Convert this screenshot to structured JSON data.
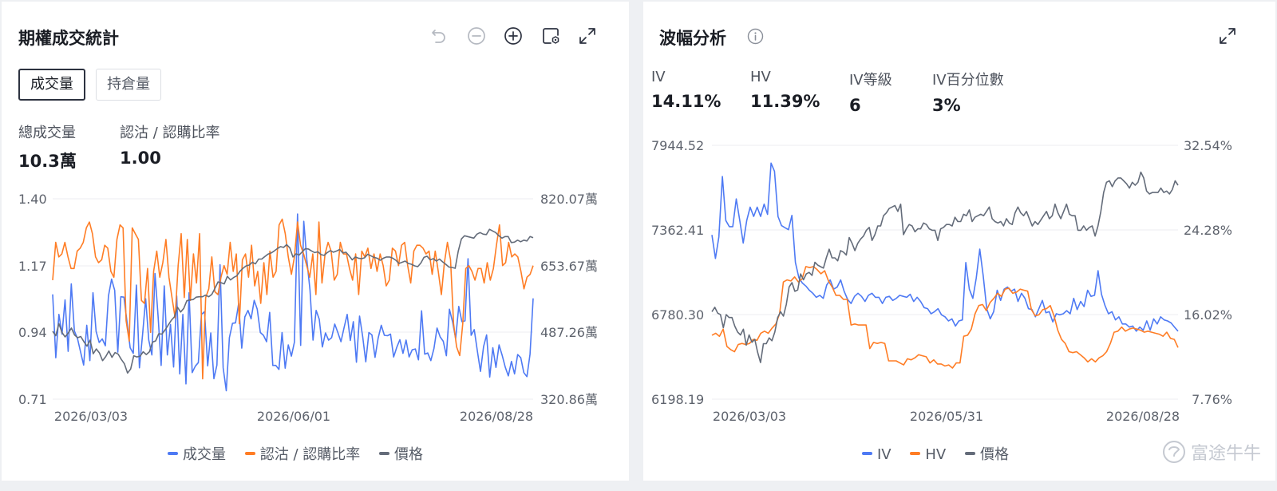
{
  "colors": {
    "volume": "#4e7af4",
    "ratio": "#ff7d25",
    "price": "#646c7a",
    "iv": "#4e7af4",
    "hv": "#ff7d25",
    "grid": "#eceef1"
  },
  "left": {
    "title": "期權成交統計",
    "toolbar_icons": [
      "undo-icon",
      "zoom-out-icon",
      "zoom-in-icon",
      "settings-icon",
      "fullscreen-icon"
    ],
    "tabs": [
      {
        "label": "成交量",
        "active": true
      },
      {
        "label": "持倉量",
        "active": false
      }
    ],
    "stats": [
      {
        "label": "總成交量",
        "value": "10.3萬"
      },
      {
        "label": "認沽 / 認購比率",
        "value": "1.00"
      }
    ],
    "legend": [
      "成交量",
      "認沽 / 認購比率",
      "價格"
    ]
  },
  "right": {
    "title": "波幅分析",
    "stats": [
      {
        "label": "IV",
        "value": "14.11%"
      },
      {
        "label": "HV",
        "value": "11.39%"
      },
      {
        "label": "IV等級",
        "value": "6"
      },
      {
        "label": "IV百分位數",
        "value": "3%"
      }
    ],
    "legend": [
      "IV",
      "HV",
      "價格"
    ]
  },
  "watermark": "富途牛牛",
  "chart_data": [
    {
      "type": "line",
      "title": "期權成交統計",
      "x_ticks": [
        "2026/03/03",
        "2026/06/01",
        "2026/08/28"
      ],
      "y_left_ticks": [
        "1.40",
        "1.17",
        "0.94",
        "0.71"
      ],
      "y_left_range": [
        0.71,
        1.4
      ],
      "y_right_ticks": [
        "820.07萬",
        "653.67萬",
        "487.26萬",
        "320.86萬"
      ],
      "y_right_range": [
        320.86,
        820.07
      ],
      "y_right_unit": "萬",
      "grid": true,
      "legend_position": "bottom",
      "series": [
        {
          "name": "成交量",
          "axis": "right",
          "values": [
            582,
            424,
            532,
            483,
            568,
            440,
            608,
            491,
            472,
            438,
            406,
            505,
            417,
            586,
            490,
            462,
            471,
            454,
            578,
            620,
            592,
            438,
            576,
            575,
            512,
            449,
            435,
            605,
            399,
            481,
            571,
            468,
            431,
            634,
            527,
            405,
            603,
            431,
            507,
            401,
            578,
            384,
            532,
            359,
            586,
            387,
            403,
            412,
            532,
            539,
            404,
            486,
            372,
            406,
            656,
            399,
            342,
            474,
            510,
            511,
            559,
            448,
            526,
            542,
            521,
            567,
            545,
            487,
            480,
            464,
            537,
            405,
            405,
            395,
            487,
            398,
            456,
            428,
            463,
            782,
            455,
            764,
            667,
            593,
            468,
            542,
            520,
            451,
            486,
            468,
            474,
            508,
            487,
            464,
            499,
            532,
            467,
            514,
            413,
            528,
            477,
            414,
            487,
            481,
            425,
            473,
            505,
            480,
            479,
            483,
            426,
            450,
            469,
            435,
            468,
            426,
            444,
            446,
            419,
            541,
            433,
            436,
            417,
            447,
            498,
            476,
            465,
            429,
            545,
            514,
            472,
            552,
            514,
            516,
            671,
            480,
            494,
            441,
            390,
            452,
            481,
            376,
            449,
            400,
            456,
            430,
            401,
            379,
            415,
            384,
            432,
            424,
            387,
            377,
            433,
            572
          ]
        },
        {
          "name": "認沽 / 認購比率",
          "axis": "left",
          "values": [
            1.12,
            1.25,
            1.2,
            1.21,
            1.25,
            1.2,
            1.16,
            1.16,
            1.22,
            1.23,
            1.25,
            1.3,
            1.32,
            1.28,
            1.2,
            1.18,
            1.19,
            1.24,
            1.23,
            1.15,
            1.13,
            1.26,
            1.31,
            1.3,
            0.98,
            0.91,
            1.3,
            1.28,
            1.26,
            1.05,
            1.04,
            1.16,
            0.94,
            1.15,
            1.22,
            1.13,
            1.18,
            1.26,
            1.13,
            1.06,
            0.99,
            1.17,
            1.28,
            1.06,
            1.26,
            1.05,
            1.21,
            1.11,
            1.28,
            0.78,
            1.06,
            1.09,
            1.2,
            1.08,
            1.07,
            1.13,
            1.17,
            1.14,
            1.25,
            1.15,
            1.21,
            0.97,
            1.19,
            1.21,
            1.13,
            1.24,
            1.1,
            1.15,
            1.04,
            1.18,
            1.07,
            1.22,
            1.13,
            1.15,
            1.31,
            1.33,
            1.28,
            1.2,
            1.14,
            1.2,
            1.32,
            1.24,
            1.21,
            1.17,
            1.13,
            1.21,
            1.07,
            1.32,
            1.11,
            1.21,
            1.25,
            1.22,
            1.12,
            1.14,
            1.25,
            1.21,
            1.21,
            1.16,
            1.12,
            1.21,
            1.07,
            1.22,
            1.2,
            1.23,
            1.16,
            1.21,
            1.15,
            1.21,
            1.17,
            1.1,
            1.12,
            1.23,
            1.22,
            1.17,
            1.24,
            1.25,
            1.17,
            1.11,
            1.22,
            1.24,
            1.24,
            1.23,
            1.21,
            1.22,
            1.14,
            1.22,
            1.15,
            1.07,
            1.18,
            1.25,
            1.19,
            0.97,
            0.89,
            0.86,
            0.97,
            1.16,
            1.17,
            1.15,
            1.12,
            1.16,
            1.16,
            1.11,
            1.18,
            1.12,
            1.16,
            1.24,
            1.31,
            1.17,
            1.18,
            1.25,
            1.2,
            1.21,
            1.2,
            1.15,
            1.09,
            1.13,
            1.14,
            1.17
          ]
        },
        {
          "name": "價格",
          "axis": "right",
          "values": [
            490,
            479,
            509,
            487,
            476,
            486,
            498,
            481,
            474,
            477,
            464,
            453,
            468,
            434,
            446,
            436,
            417,
            427,
            441,
            425,
            437,
            433,
            420,
            409,
            386,
            396,
            429,
            426,
            428,
            439,
            432,
            439,
            463,
            466,
            484,
            483,
            493,
            505,
            517,
            526,
            550,
            538,
            547,
            566,
            568,
            569,
            575,
            576,
            576,
            580,
            576,
            582,
            597,
            613,
            611,
            608,
            627,
            618,
            624,
            628,
            639,
            647,
            653,
            655,
            662,
            658,
            670,
            670,
            676,
            682,
            685,
            690,
            696,
            701,
            699,
            706,
            698,
            675,
            683,
            680,
            688,
            696,
            695,
            690,
            686,
            688,
            681,
            679,
            686,
            691,
            687,
            690,
            694,
            685,
            687,
            678,
            668,
            675,
            672,
            671,
            673,
            682,
            678,
            674,
            672,
            667,
            672,
            675,
            675,
            672,
            667,
            659,
            662,
            665,
            659,
            657,
            653,
            651,
            660,
            674,
            677,
            668,
            671,
            665,
            670,
            663,
            657,
            650,
            649,
            647,
            690,
            720,
            728,
            726,
            724,
            722,
            732,
            736,
            732,
            731,
            744,
            740,
            736,
            728,
            722,
            726,
            726,
            711,
            712,
            717,
            713,
            717,
            715,
            726,
            723
          ]
        }
      ]
    },
    {
      "type": "line",
      "title": "波幅分析",
      "x_ticks": [
        "2026/03/03",
        "2026/05/31",
        "2026/08/28"
      ],
      "y_left_ticks": [
        "7944.52",
        "7362.41",
        "6780.30",
        "6198.19"
      ],
      "y_left_range": [
        6198.19,
        7944.52
      ],
      "y_right_ticks": [
        "32.54%",
        "24.28%",
        "16.02%",
        "7.76%"
      ],
      "y_right_range": [
        7.76,
        32.54
      ],
      "y_right_unit": "%",
      "grid": true,
      "legend_position": "bottom",
      "series": [
        {
          "name": "IV",
          "axis": "right",
          "values": [
            23.8,
            21.5,
            23.6,
            29.5,
            25.2,
            24.6,
            24.6,
            27.3,
            25.2,
            23.0,
            25.2,
            26.5,
            25.6,
            26.5,
            25.6,
            26.8,
            25.8,
            30.8,
            30.0,
            25.6,
            24.7,
            24.5,
            24.3,
            25.7,
            21.1,
            19.6,
            19.1,
            18.8,
            18.4,
            18.1,
            17.7,
            17.9,
            17.6,
            18.9,
            19.4,
            18.5,
            18.7,
            19.4,
            18.3,
            17.5,
            17.1,
            17.8,
            18.1,
            17.8,
            17.3,
            17.9,
            18.1,
            17.7,
            17.7,
            17.1,
            17.7,
            17.8,
            17.4,
            17.6,
            17.9,
            17.8,
            17.7,
            18.0,
            17.3,
            17.7,
            17.3,
            16.7,
            16.6,
            16.1,
            16.3,
            16.6,
            16.0,
            15.8,
            15.4,
            15.6,
            14.9,
            15.4,
            15.5,
            21.1,
            18.5,
            17.6,
            19.6,
            22.4,
            19.8,
            16.6,
            15.6,
            16.3,
            18.4,
            17.4,
            18.5,
            18.7,
            18.3,
            18.5,
            17.3,
            18.1,
            17.6,
            16.6,
            16.5,
            15.8,
            16.6,
            17.4,
            16.2,
            16.3,
            15.3,
            16.1,
            16.0,
            16.1,
            16.4,
            16.1,
            17.6,
            16.5,
            17.3,
            16.8,
            18.4,
            17.8,
            17.9,
            20.3,
            18.0,
            16.9,
            16.1,
            16.3,
            15.5,
            15.8,
            15.1,
            15.1,
            14.8,
            14.9,
            14.4,
            14.8,
            14.5,
            15.4,
            14.5,
            15.6,
            15.1,
            15.8,
            15.5,
            15.4,
            15.2,
            14.8,
            14.4
          ]
        },
        {
          "name": "HV",
          "axis": "right",
          "values": [
            14.0,
            14.2,
            13.9,
            14.6,
            12.9,
            12.6,
            12.4,
            13.1,
            13.2,
            13.1,
            13.2,
            13.6,
            13.5,
            14.2,
            14.4,
            14.2,
            14.7,
            15.1,
            16.1,
            19.2,
            19.4,
            19.3,
            19.7,
            19.2,
            19.5,
            20.7,
            20.6,
            20.7,
            20.4,
            20.0,
            20.3,
            19.3,
            18.7,
            17.9,
            17.9,
            17.5,
            17.5,
            15.0,
            15.1,
            15.0,
            15.0,
            15.0,
            12.7,
            13.3,
            13.2,
            13.3,
            13.2,
            11.5,
            11.5,
            11.5,
            11.3,
            11.1,
            11.7,
            11.6,
            11.8,
            12.1,
            12.0,
            11.9,
            11.3,
            11.6,
            11.2,
            11.2,
            11.0,
            11.1,
            10.8,
            11.3,
            11.3,
            13.9,
            14.0,
            14.6,
            16.1,
            16.9,
            17.0,
            16.4,
            17.2,
            17.6,
            18.1,
            17.8,
            18.5,
            18.6,
            18.1,
            18.2,
            18.5,
            18.4,
            18.3,
            16.5,
            15.9,
            16.0,
            16.5,
            16.6,
            16.9,
            15.9,
            14.5,
            13.6,
            13.2,
            12.4,
            12.3,
            12.4,
            12.1,
            11.8,
            11.4,
            11.7,
            11.4,
            11.8,
            12.0,
            12.4,
            13.2,
            14.3,
            14.4,
            14.8,
            14.4,
            14.6,
            14.7,
            14.6,
            14.5,
            14.3,
            14.4,
            14.3,
            14.2,
            14.1,
            13.9,
            14.3,
            13.7,
            13.6,
            12.8
          ]
        },
        {
          "name": "價格",
          "axis": "left",
          "values": [
            6800,
            6830,
            6790,
            6780,
            6690,
            6780,
            6760,
            6760,
            6700,
            6660,
            6640,
            6680,
            6570,
            6640,
            6590,
            6610,
            6520,
            6450,
            6580,
            6580,
            6620,
            6600,
            6660,
            6760,
            6800,
            6770,
            6850,
            6970,
            7000,
            6940,
            6950,
            7060,
            7020,
            7060,
            7070,
            7050,
            7140,
            7120,
            7110,
            7100,
            7170,
            7230,
            7170,
            7170,
            7150,
            7220,
            7210,
            7190,
            7310,
            7270,
            7220,
            7270,
            7300,
            7320,
            7360,
            7380,
            7290,
            7330,
            7390,
            7390,
            7460,
            7480,
            7510,
            7520,
            7530,
            7490,
            7540,
            7330,
            7370,
            7400,
            7390,
            7350,
            7370,
            7370,
            7410,
            7400,
            7370,
            7360,
            7360,
            7290,
            7370,
            7380,
            7400,
            7400,
            7390,
            7450,
            7420,
            7420,
            7470,
            7460,
            7500,
            7420,
            7450,
            7460,
            7470,
            7460,
            7490,
            7520,
            7440,
            7420,
            7410,
            7420,
            7390,
            7440,
            7410,
            7400,
            7480,
            7520,
            7480,
            7460,
            7490,
            7440,
            7390,
            7420,
            7400,
            7430,
            7460,
            7490,
            7440,
            7460,
            7540,
            7480,
            7440,
            7490,
            7540,
            7470,
            7460,
            7460,
            7360,
            7360,
            7390,
            7360,
            7380,
            7390,
            7320,
            7390,
            7490,
            7620,
            7690,
            7700,
            7660,
            7700,
            7720,
            7720,
            7700,
            7680,
            7650,
            7690,
            7670,
            7690,
            7760,
            7720,
            7630,
            7610,
            7620,
            7620,
            7620,
            7650,
            7620,
            7630,
            7610,
            7640,
            7700,
            7670
          ]
        }
      ]
    }
  ]
}
